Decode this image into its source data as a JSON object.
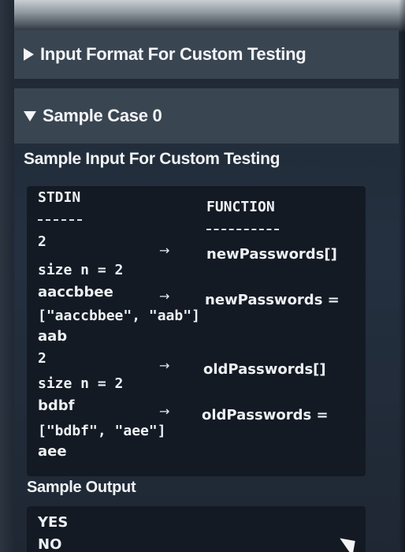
{
  "sections": {
    "input_format": {
      "label": "Input Format For Custom Testing",
      "expanded": false,
      "icon": "triangle-right-icon"
    },
    "sample_case": {
      "label": "Sample Case 0",
      "expanded": true,
      "icon": "triangle-down-icon"
    }
  },
  "sample_input": {
    "heading": "Sample Input For Custom Testing",
    "stdin_header": "STDIN",
    "stdin_dashes": "-----",
    "function_header": "FUNCTION",
    "function_dashes": "--------",
    "arrow_glyph": "→",
    "lines": {
      "l1": "2",
      "l1_fn": "newPasswords[]",
      "l2": "size n = 2",
      "l3": "aaccbbee",
      "l3_fn": "newPasswords =",
      "l4": "[\"aaccbbee\", \"aab\"]",
      "l5": "aab",
      "l6": "2",
      "l6_fn": "oldPasswords[]",
      "l7": "size n = 2",
      "l8": "bdbf",
      "l8_fn": "oldPasswords =",
      "l9": "[\"bdbf\", \"aee\"]",
      "l10": "aee"
    }
  },
  "sample_output": {
    "heading": "Sample Output",
    "lines": [
      "YES",
      "NO"
    ]
  },
  "colors": {
    "background": "#1f2833",
    "section_bar": "#3a4552",
    "code_box": "#141a23",
    "text": "#eef1f4"
  }
}
